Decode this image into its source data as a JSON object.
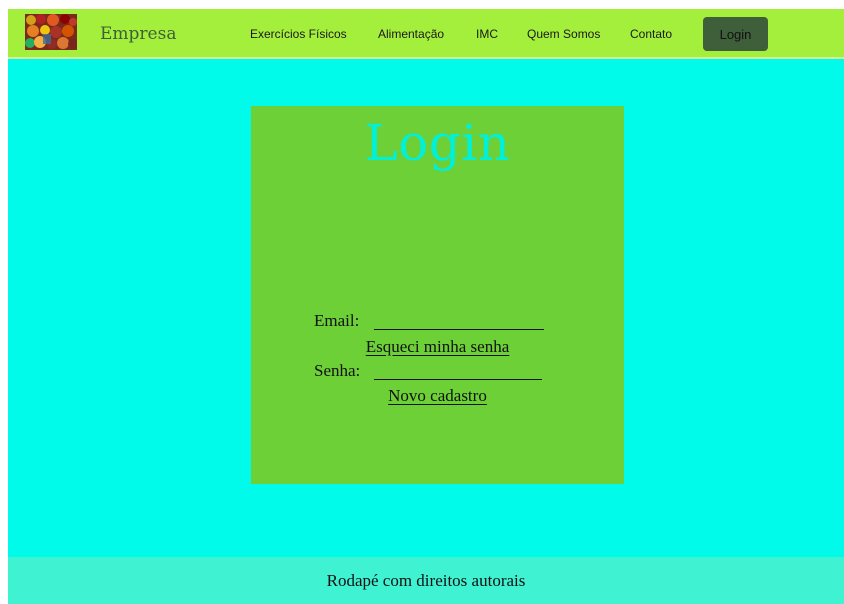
{
  "navbar": {
    "brand": "Empresa",
    "logo_icon": "fruit-basket-logo-icon",
    "links": [
      {
        "label": "Exercícios Físicos"
      },
      {
        "label": "Alimentação"
      },
      {
        "label": "IMC"
      },
      {
        "label": "Quem Somos"
      },
      {
        "label": "Contato"
      }
    ],
    "login_button": "Login",
    "colors": {
      "bar": "#a4ee3c",
      "login_button": "#3f5e3a"
    }
  },
  "login_card": {
    "title": "Login",
    "email_label": "Email:",
    "password_label": "Senha:",
    "forgot_password": "Esqueci minha senha",
    "new_account": "Novo cadastro",
    "colors": {
      "card": "#6cd036",
      "title": "#00f0d8"
    }
  },
  "footer": {
    "text": "Rodapé com direitos autorais",
    "color": "#3ff2d2"
  },
  "page": {
    "background": "#00fbea"
  }
}
